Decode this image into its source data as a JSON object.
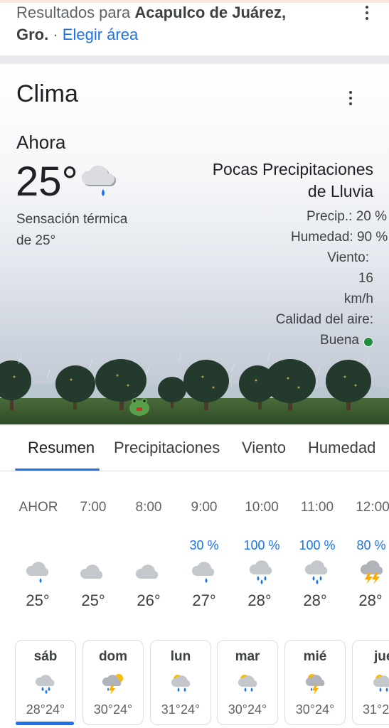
{
  "header": {
    "results_prefix": "Resultados para ",
    "location_bold_1": "Acapulco de Juárez,",
    "location_bold_2": "Gro.",
    "separator": " · ",
    "choose_area": "Elegir área"
  },
  "weather": {
    "title": "Clima",
    "now_label": "Ahora",
    "temp": "25°",
    "feels_like_1": "Sensación térmica",
    "feels_like_2": "de 25°",
    "condition_1": "Pocas Precipitaciones",
    "condition_2": "de Lluvia",
    "precip": "Precip.: 20 %",
    "humidity": "Humedad: 90 %",
    "wind_label": "Viento:",
    "wind_value": "16",
    "wind_unit": "km/h",
    "air_label": "Calidad del aire:",
    "air_value": "Buena",
    "air_color": "#1e8e3e"
  },
  "tabs": [
    "Resumen",
    "Precipitaciones",
    "Viento",
    "Humedad"
  ],
  "hourly": [
    {
      "time": "AHOR",
      "pct": "",
      "temp": "25°",
      "icon": "rain-cloud-icon"
    },
    {
      "time": "7:00",
      "pct": "",
      "temp": "25°",
      "icon": "cloud-icon"
    },
    {
      "time": "8:00",
      "pct": "",
      "temp": "26°",
      "icon": "cloud-icon"
    },
    {
      "time": "9:00",
      "pct": "30 %",
      "temp": "27°",
      "icon": "rain-cloud-icon"
    },
    {
      "time": "10:00",
      "pct": "100 %",
      "temp": "28°",
      "icon": "heavy-rain-cloud-icon"
    },
    {
      "time": "11:00",
      "pct": "100 %",
      "temp": "28°",
      "icon": "heavy-rain-cloud-icon"
    },
    {
      "time": "12:00",
      "pct": "80 %",
      "temp": "28°",
      "icon": "thunderstorm-icon"
    }
  ],
  "daily": [
    {
      "day": "sáb",
      "temps": "28°24°",
      "icon": "heavy-rain-cloud-icon"
    },
    {
      "day": "dom",
      "temps": "30°24°",
      "icon": "thunderstorm-sun-icon"
    },
    {
      "day": "lun",
      "temps": "31°24°",
      "icon": "sun-rain-icon"
    },
    {
      "day": "mar",
      "temps": "30°24°",
      "icon": "sun-rain-icon"
    },
    {
      "day": "mié",
      "temps": "30°24°",
      "icon": "thunderstorm-sun-icon"
    },
    {
      "day": "jue",
      "temps": "31°2",
      "icon": "sun-rain-icon"
    }
  ],
  "colors": {
    "accent": "#1a73e8",
    "text": "#202124"
  }
}
